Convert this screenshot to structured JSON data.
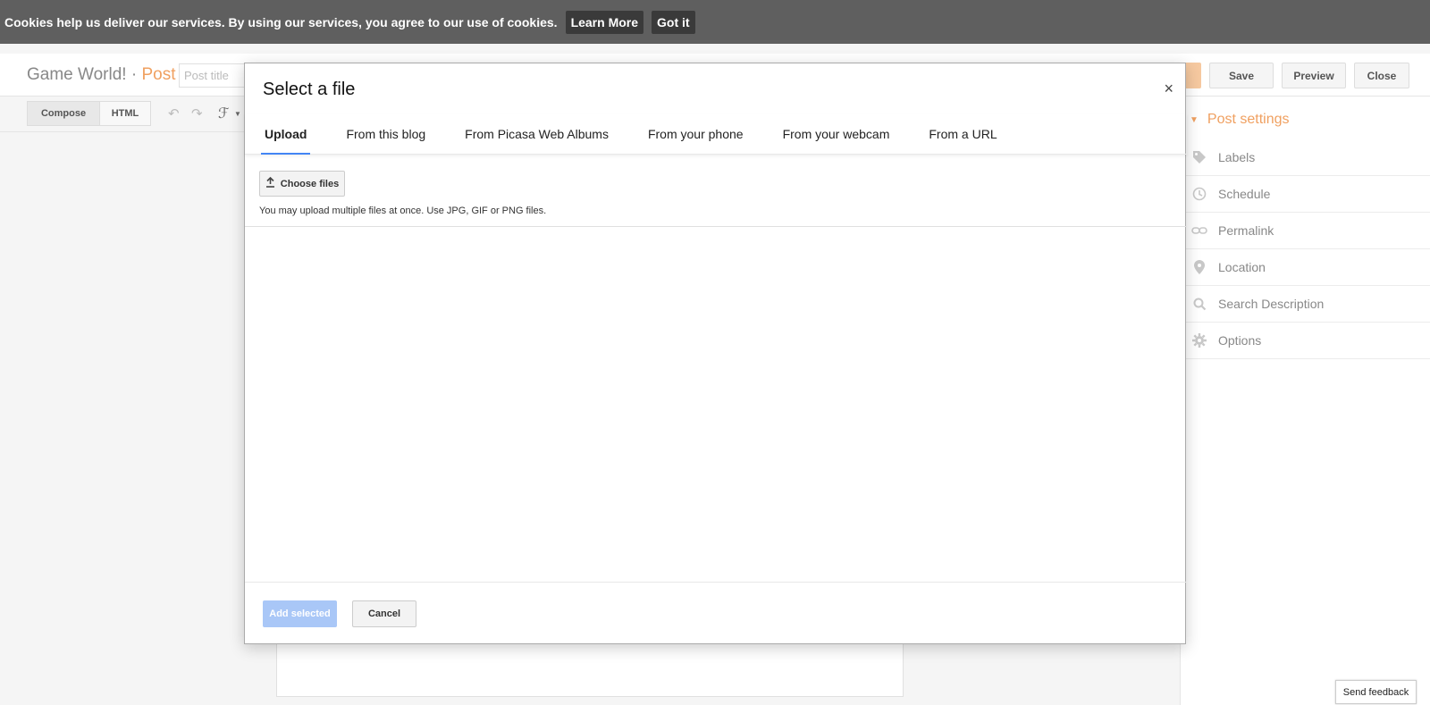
{
  "cookie_bar": {
    "message": "Cookies help us deliver our services. By using our services, you agree to our use of cookies.",
    "learn_more": "Learn More",
    "got_it": "Got it"
  },
  "header": {
    "blog_name": "Game World!",
    "separator": "·",
    "section": "Post",
    "title_placeholder": "Post title",
    "save_label": "Save",
    "preview_label": "Preview",
    "close_label": "Close"
  },
  "toolbar": {
    "compose_label": "Compose",
    "html_label": "HTML",
    "undo_icon": "↶",
    "redo_icon": "↷",
    "font_icon": "ℱ"
  },
  "settings": {
    "title": "Post settings",
    "items": [
      {
        "label": "Labels",
        "icon": "label-icon"
      },
      {
        "label": "Schedule",
        "icon": "clock-icon"
      },
      {
        "label": "Permalink",
        "icon": "link-icon"
      },
      {
        "label": "Location",
        "icon": "location-pin-icon"
      },
      {
        "label": "Search Description",
        "icon": "search-icon"
      },
      {
        "label": "Options",
        "icon": "gear-icon"
      }
    ]
  },
  "feedback_label": "Send feedback",
  "modal": {
    "title": "Select a file",
    "close_glyph": "×",
    "tabs": [
      {
        "label": "Upload",
        "active": true
      },
      {
        "label": "From this blog",
        "active": false
      },
      {
        "label": "From Picasa Web Albums",
        "active": false
      },
      {
        "label": "From your phone",
        "active": false
      },
      {
        "label": "From your webcam",
        "active": false
      },
      {
        "label": "From a URL",
        "active": false
      }
    ],
    "choose_files_label": "Choose files",
    "hint": "You may upload multiple files at once. Use JPG, GIF or PNG files.",
    "add_selected_label": "Add selected",
    "cancel_label": "Cancel"
  },
  "colors": {
    "cookie_bar_bg": "#5f5f5f",
    "accent_orange": "#f0a060",
    "tab_underline": "#4285f4",
    "add_selected_disabled": "#a9c7f7"
  }
}
